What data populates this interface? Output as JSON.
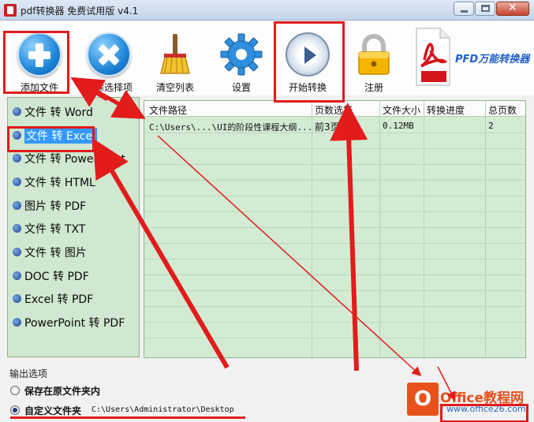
{
  "window": {
    "title": "pdf转换器 免费试用版 v4.1"
  },
  "toolbar": {
    "add_file": "添加文件",
    "delete_selected": "删除选择项",
    "clear_list": "清空列表",
    "settings": "设置",
    "start_convert": "开始转换",
    "register": "注册",
    "brand": "PFD万能转换器"
  },
  "convert_types": [
    {
      "label": "文件 转 Word",
      "selected": false
    },
    {
      "label": "文件 转 Excel",
      "selected": true
    },
    {
      "label": "文件 转 PowerPoint",
      "selected": false
    },
    {
      "label": "文件 转 HTML",
      "selected": false
    },
    {
      "label": "图片 转 PDF",
      "selected": false
    },
    {
      "label": "文件 转 TXT",
      "selected": false
    },
    {
      "label": "文件 转 图片",
      "selected": false
    },
    {
      "label": "DOC 转 PDF",
      "selected": false
    },
    {
      "label": "Excel 转 PDF",
      "selected": false
    },
    {
      "label": "PowerPoint 转 PDF",
      "selected": false
    }
  ],
  "table": {
    "headers": [
      "文件路径",
      "页数选择",
      "文件大小",
      "转换进度",
      "总页数"
    ],
    "rows": [
      {
        "path": "C:\\Users\\...\\UI的阶段性课程大纲...",
        "pages": "前3页",
        "size": "0.12MB",
        "progress": "",
        "total": "2"
      }
    ]
  },
  "output": {
    "title": "输出选项",
    "option_original": "保存在原文件夹内",
    "option_custom": "自定义文件夹",
    "custom_path": "C:\\Users\\Administrator\\Desktop",
    "selected": "custom"
  },
  "watermark": {
    "title": "Office教程网",
    "url": "www.office26.com"
  },
  "colors": {
    "accent_red": "#e21b1b",
    "panel_green": "#cfe8cf",
    "selection_blue": "#3399ff"
  }
}
